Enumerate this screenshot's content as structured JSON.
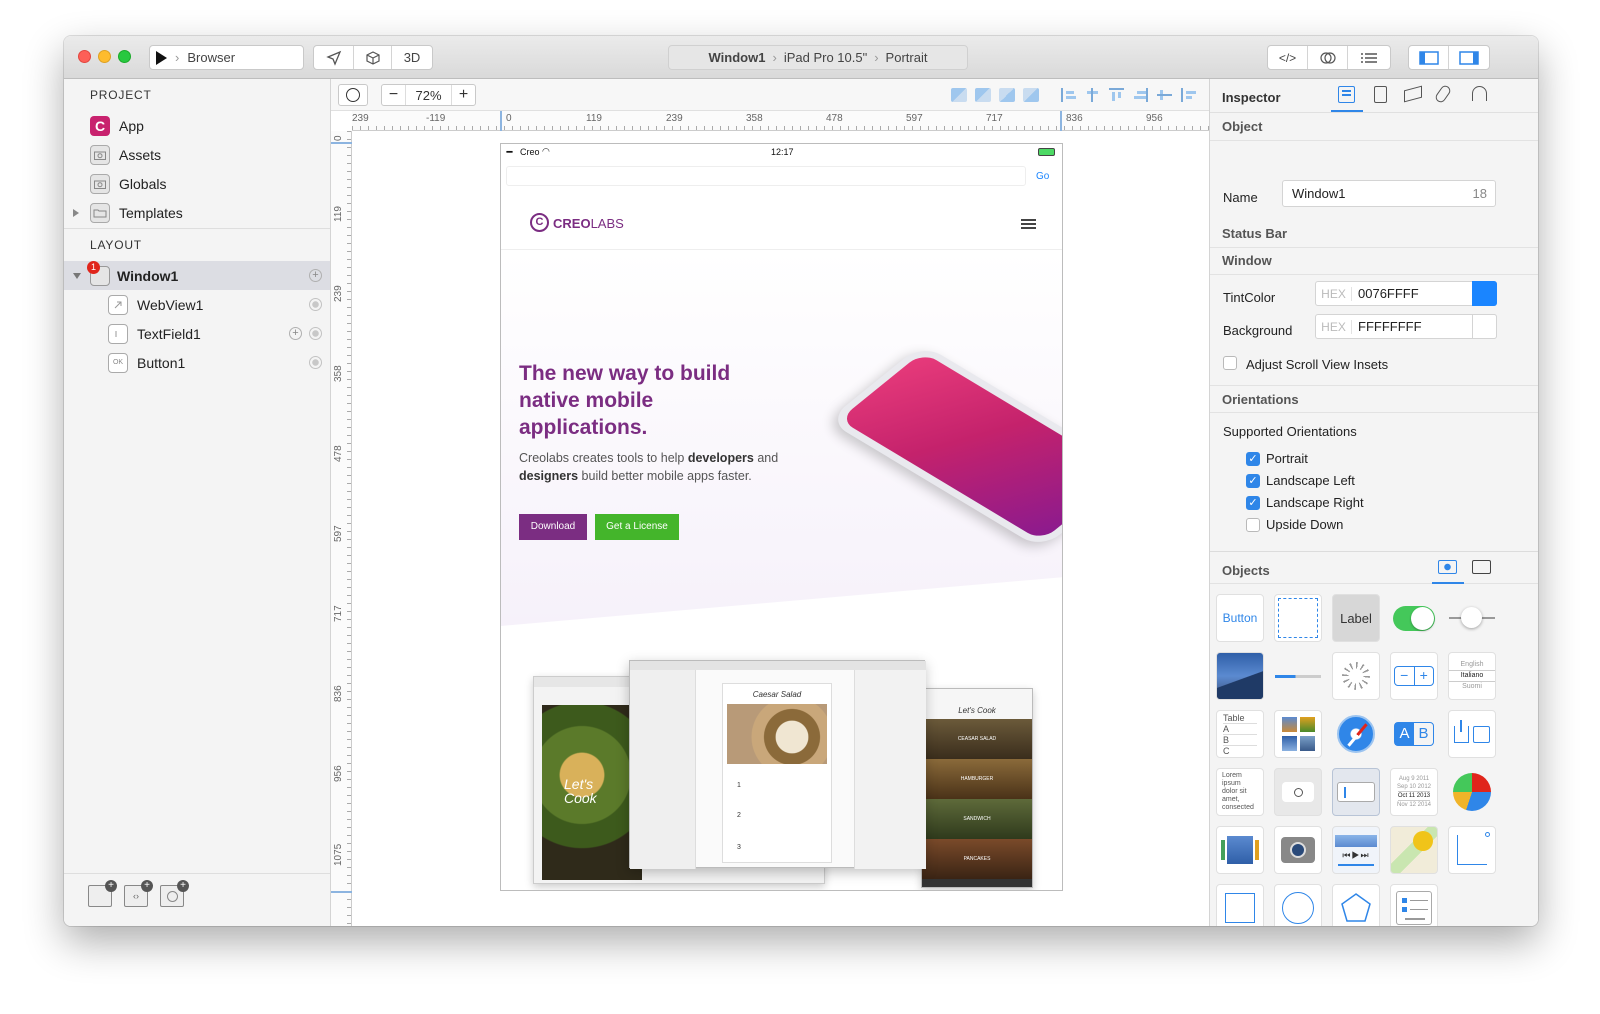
{
  "toolbar": {
    "run_target": "Browser",
    "mode_3d": "3D",
    "breadcrumb": [
      "Window1",
      "iPad Pro 10.5\"",
      "Portrait"
    ],
    "code_icon": "</>"
  },
  "project": {
    "section_title": "PROJECT",
    "items": [
      {
        "label": "App",
        "icon": "app-icon"
      },
      {
        "label": "Assets",
        "icon": "camera-icon"
      },
      {
        "label": "Globals",
        "icon": "camera-icon"
      },
      {
        "label": "Templates",
        "icon": "folder-icon"
      }
    ]
  },
  "layout": {
    "section_title": "LAYOUT",
    "window": {
      "label": "Window1",
      "badge": "1"
    },
    "children": [
      {
        "label": "WebView1"
      },
      {
        "label": "TextField1"
      },
      {
        "label": "Button1"
      }
    ]
  },
  "canvas": {
    "zoom": "72%",
    "ruler_h": [
      "239",
      "-119",
      "0",
      "119",
      "239",
      "358",
      "478",
      "597",
      "717",
      "836",
      "956"
    ],
    "ruler_v": [
      "0",
      "119",
      "239",
      "358",
      "478",
      "597",
      "717",
      "836",
      "956",
      "1075"
    ]
  },
  "device": {
    "carrier": "Creo",
    "time": "12:17",
    "go_label": "Go",
    "logo_text_bold": "CREO",
    "logo_text_light": "LABS",
    "hero_title": "The new way to build native mobile applications.",
    "hero_text_1": "Creolabs creates tools to help ",
    "hero_bold_1": "developers",
    "hero_text_2": " and ",
    "hero_bold_2": "designers",
    "hero_text_3": " build better mobile apps faster.",
    "download_label": "Download",
    "license_label": "Get a License",
    "mock_left_text": "Let's Cook",
    "mock_center_title": "Caesar Salad",
    "mock_right_title": "Let's Cook",
    "mock_right_items": [
      "CEASAR SALAD",
      "HAMBURGER",
      "SANDWICH",
      "PANCAKES"
    ],
    "mock_center_steps": [
      "1",
      "2",
      "3"
    ],
    "colors": {
      "brand": "#7b2d82",
      "license": "#44b52b"
    }
  },
  "inspector": {
    "title": "Inspector",
    "object_section": "Object",
    "name_label": "Name",
    "name_value": "Window1",
    "name_count": "18",
    "status_bar_section": "Status Bar",
    "window_section": "Window",
    "tint_label": "TintColor",
    "tint_hex_prefix": "HEX",
    "tint_value": "0076FFFF",
    "tint_color": "#1a85ff",
    "background_label": "Background",
    "background_hex_prefix": "HEX",
    "background_value": "FFFFFFFF",
    "adjust_label": "Adjust Scroll View Insets",
    "orientations_section": "Orientations",
    "supported_label": "Supported Orientations",
    "orientations": [
      {
        "label": "Portrait",
        "checked": true
      },
      {
        "label": "Landscape Left",
        "checked": true
      },
      {
        "label": "Landscape Right",
        "checked": true
      },
      {
        "label": "Upside Down",
        "checked": false
      }
    ]
  },
  "objects": {
    "title": "Objects",
    "button_tile": "Button",
    "label_tile": "Label",
    "table_tile": [
      "Table",
      "A",
      "B",
      "C"
    ],
    "textview_tile": [
      "Lorem",
      "ipsum",
      "dolor sit",
      "amet,",
      "consected"
    ],
    "picker_tile": [
      "English",
      "Italiano",
      "Suomi"
    ],
    "datepicker_tile": [
      "Aug 9 2011",
      "Sep 10 2012",
      "Oct 11 2013",
      "Nov 12 2014"
    ]
  }
}
